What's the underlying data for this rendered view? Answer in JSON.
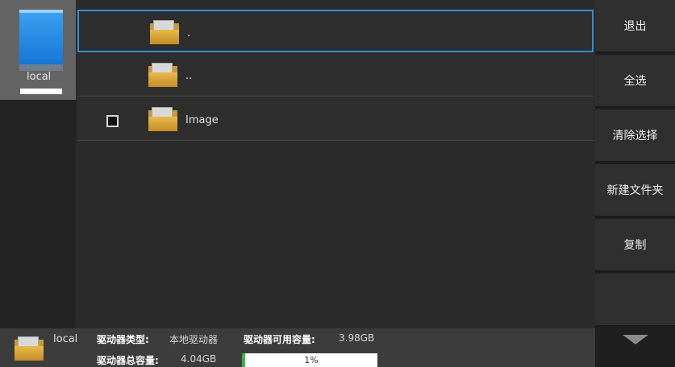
{
  "drive_panel": {
    "items": [
      {
        "label": "local",
        "icon": "drive-icon"
      }
    ]
  },
  "file_list": {
    "rows": [
      {
        "name": ".",
        "icon": "folder-icon",
        "checkbox": false,
        "selected": true
      },
      {
        "name": "..",
        "icon": "folder-icon",
        "checkbox": false,
        "selected": false
      },
      {
        "name": "Image",
        "icon": "folder-icon",
        "checkbox": true,
        "selected": false
      }
    ]
  },
  "actions": {
    "buttons": [
      {
        "label": "退出"
      },
      {
        "label": "全选"
      },
      {
        "label": "清除选择"
      },
      {
        "label": "新建文件夹"
      },
      {
        "label": "复制"
      },
      {
        "label": ""
      }
    ],
    "scroll_icon": "triangle-down-icon"
  },
  "status": {
    "drive_name": "local",
    "type_label": "驱动器类型:",
    "type_value": "本地驱动器",
    "free_label": "驱动器可用容量:",
    "free_value": "3.98GB",
    "total_label": "驱动器总容量:",
    "total_value": "4.04GB",
    "usage_percent_text": "1%",
    "usage_fraction": 0.01
  },
  "colors": {
    "selection_border": "#2f8fd6",
    "usage_fill": "#3cb34a",
    "drive_selected_bg": "#646464"
  }
}
